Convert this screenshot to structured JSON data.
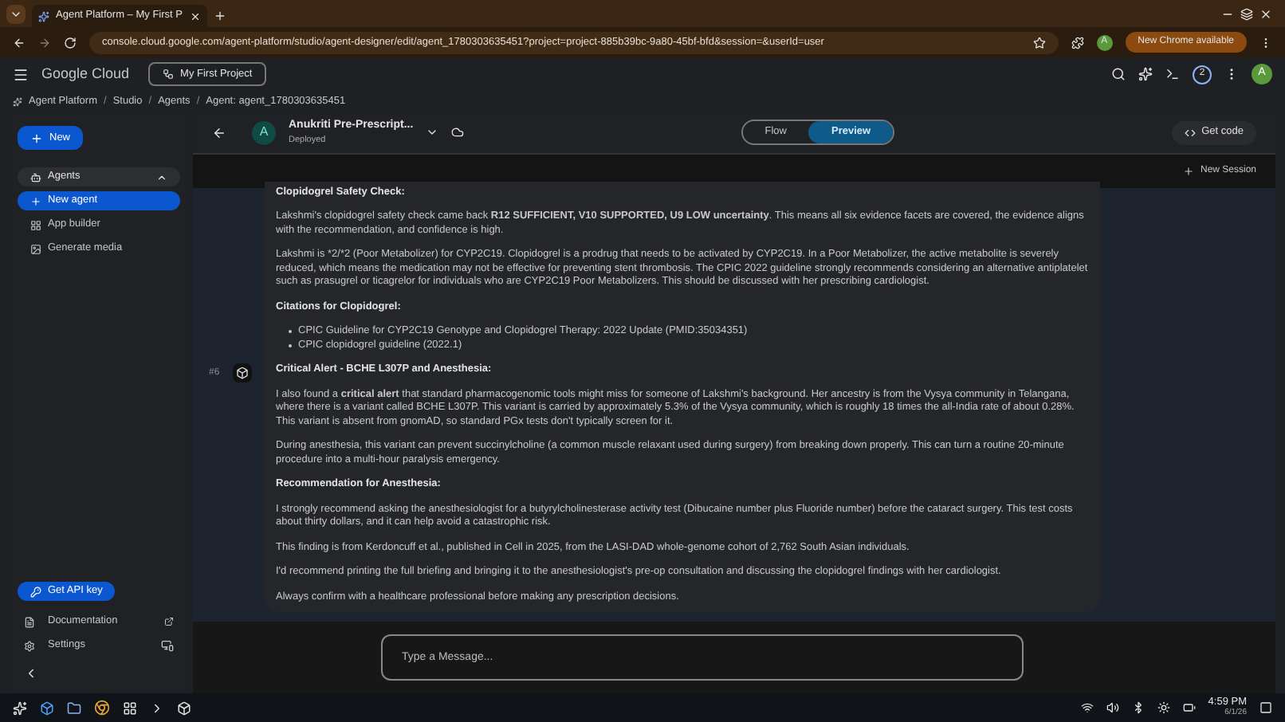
{
  "browser": {
    "tab_title": "Agent Platform – My First P",
    "url": "console.cloud.google.com/agent-platform/studio/agent-designer/edit/agent_1780303635451?project=project-885b39bc-9a80-45bf-bfd&session=&userId=user",
    "profile": "A",
    "update_chip": "New Chrome available"
  },
  "header": {
    "logo": "Google Cloud",
    "project": "My First Project",
    "notifications": "2",
    "avatar": "A"
  },
  "breadcrumbs": [
    {
      "label": "Agent Platform"
    },
    {
      "separator": "/",
      "label": "Studio"
    },
    {
      "separator": "/",
      "label": "Agents"
    },
    {
      "separator": "/",
      "label": "Agent: agent_1780303635451"
    }
  ],
  "sidebar": {
    "new_button": "New",
    "group": {
      "label": "Agents",
      "expanded": true
    },
    "items": [
      {
        "label": "New agent",
        "selected": true
      },
      {
        "label": "App builder",
        "selected": false
      },
      {
        "label": "Generate media",
        "selected": false
      }
    ],
    "api_key": "Get API key",
    "footer": [
      {
        "label": "Documentation"
      },
      {
        "label": "Settings"
      }
    ]
  },
  "agent": {
    "avatar": "A",
    "name": "Anukriti Pre-Prescript...",
    "status": "Deployed"
  },
  "view_toggle": [
    {
      "label": "Flow",
      "selected": false
    },
    {
      "label": "Preview",
      "selected": true
    }
  ],
  "get_code": "Get code",
  "new_session": "New Session",
  "messages": [
    {
      "blocks": [
        {
          "kind": "heading",
          "text": "Clopidogrel Safety Check:"
        },
        {
          "kind": "paragraph",
          "text": "Lakshmi's clopidogrel safety check came back **R12 SUFFICIENT, V10 SUPPORTED, U9 LOW uncertainty**. This means all six evidence facets are covered, the evidence aligns with the recommendation, and confidence is high."
        },
        {
          "kind": "paragraph",
          "text": "Lakshmi is *2/*2 (Poor Metabolizer) for CYP2C19. Clopidogrel is a prodrug that needs to be activated by CYP2C19. In a Poor Metabolizer, the active metabolite is severely reduced, which means the medication may not be effective for preventing stent thrombosis. The CPIC 2022 guideline strongly recommends considering an alternative antiplatelet such as prasugrel or ticagrelor for individuals who are CYP2C19 Poor Metabolizers. This should be discussed with her prescribing cardiologist."
        },
        {
          "kind": "heading",
          "text": "Citations for Clopidogrel:"
        },
        {
          "kind": "list",
          "items": [
            "CPIC Guideline for CYP2C19 Genotype and Clopidogrel Therapy: 2022 Update (PMID:35034351)",
            "CPIC clopidogrel guideline (2022.1)"
          ]
        }
      ]
    },
    {
      "number": "#6",
      "blocks": [
        {
          "kind": "heading",
          "text": "Critical Alert - BCHE L307P and Anesthesia:"
        },
        {
          "kind": "paragraph",
          "text": "I also found a **critical alert** that standard pharmacogenomic tools might miss for someone of Lakshmi's background. Her ancestry is from the Vysya community in Telangana, where there is a variant called BCHE L307P. This variant is carried by approximately 5.3% of the Vysya community, which is roughly 18 times the all-India rate of about 0.28%. This variant is absent from gnomAD, so standard PGx tests don't typically screen for it."
        },
        {
          "kind": "paragraph",
          "text": "During anesthesia, this variant can prevent succinylcholine (a common muscle relaxant used during surgery) from breaking down properly. This can turn a routine 20-minute procedure into a multi-hour paralysis emergency."
        },
        {
          "kind": "heading",
          "text": "Recommendation for Anesthesia:"
        },
        {
          "kind": "paragraph",
          "text": "I strongly recommend asking the anesthesiologist for a butyrylcholinesterase activity test (Dibucaine number plus Fluoride number) before the cataract surgery. This test costs about thirty dollars, and it can help avoid a catastrophic risk."
        },
        {
          "kind": "paragraph",
          "text": "This finding is from Kerdoncuff et al., published in Cell in 2025, from the LASI-DAD whole-genome cohort of 2,762 South Asian individuals."
        },
        {
          "kind": "paragraph",
          "text": "I'd recommend printing the full briefing and bringing it to the anesthesiologist's pre-op consultation and discussing the clopidogrel findings with her cardiologist."
        },
        {
          "kind": "paragraph",
          "text": "Always confirm with a healthcare professional before making any prescription decisions."
        }
      ]
    }
  ],
  "composer": {
    "placeholder": "Type a Message..."
  },
  "taskbar": {
    "time": "4:59 PM",
    "date": "6/1/26"
  }
}
